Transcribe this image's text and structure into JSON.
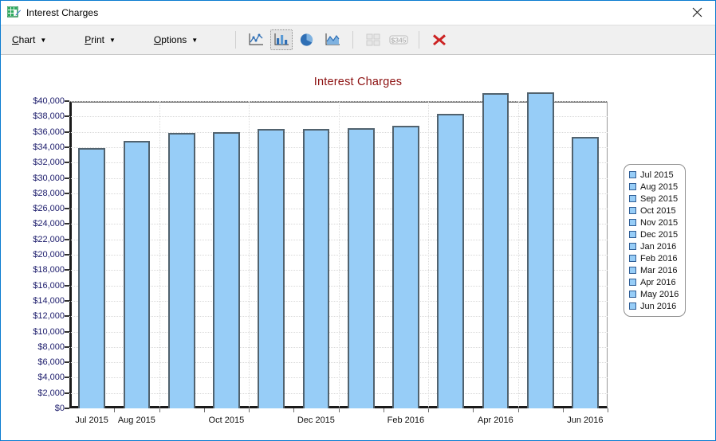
{
  "window": {
    "title": "Interest Charges",
    "icon": "spreadsheet-pen-icon",
    "close_label": "✕"
  },
  "toolbar": {
    "menus": [
      {
        "mnemonic": "C",
        "rest": "hart",
        "caret": "▼",
        "name": "chart"
      },
      {
        "mnemonic": "P",
        "rest": "rint",
        "caret": "▼",
        "name": "print"
      },
      {
        "mnemonic": "O",
        "rest": "ptions",
        "caret": "▼",
        "name": "options"
      }
    ],
    "buttons": [
      {
        "icon": "line-chart-icon",
        "selected": false,
        "disabled": false
      },
      {
        "icon": "bar-chart-icon",
        "selected": true,
        "disabled": false
      },
      {
        "icon": "pie-chart-icon",
        "selected": false,
        "disabled": false
      },
      {
        "icon": "area-chart-icon",
        "selected": false,
        "disabled": false
      },
      {
        "icon": "grid-table-icon",
        "selected": false,
        "disabled": true
      },
      {
        "icon": "numbers-345-icon",
        "selected": false,
        "disabled": true
      },
      {
        "icon": "close-red-x-icon",
        "selected": false,
        "disabled": false
      }
    ],
    "numbers_icon_text": "$345"
  },
  "colors": {
    "bar_fill": "#97cdf7",
    "bar_border": "#51626e",
    "title_text": "#8c1010",
    "axis_label": "#1b1b6b",
    "legend_swatch_border": "#2f5e96",
    "close_x": "#cc2222",
    "window_border": "#0a7bd0"
  },
  "chart_data": {
    "type": "bar",
    "title": "Interest Charges",
    "xlabel": "",
    "ylabel": "",
    "ylim": [
      0,
      40000
    ],
    "ytick_step": 2000,
    "grid": true,
    "legend_position": "right",
    "categories": [
      "Jul 2015",
      "Aug 2015",
      "Sep 2015",
      "Oct 2015",
      "Nov 2015",
      "Dec 2015",
      "Jan 2016",
      "Feb 2016",
      "Mar 2016",
      "Apr 2016",
      "May 2016",
      "Jun 2016"
    ],
    "values": [
      33900,
      34800,
      35900,
      36000,
      36400,
      36400,
      36500,
      36800,
      38300,
      41000,
      41100,
      35300
    ],
    "ytick_labels": [
      "$0",
      "$2,000",
      "$4,000",
      "$6,000",
      "$8,000",
      "$10,000",
      "$12,000",
      "$14,000",
      "$16,000",
      "$18,000",
      "$20,000",
      "$22,000",
      "$24,000",
      "$26,000",
      "$28,000",
      "$30,000",
      "$32,000",
      "$34,000",
      "$36,000",
      "$38,000",
      "$40,000"
    ],
    "xtick_labels_shown": [
      "Jul 2015",
      "Aug 2015",
      "",
      "Oct 2015",
      "",
      "Dec 2015",
      "",
      "Feb 2016",
      "",
      "Apr 2016",
      "",
      "Jun 2016"
    ],
    "legend_entries": [
      "Jul 2015",
      "Aug 2015",
      "Sep 2015",
      "Oct 2015",
      "Nov 2015",
      "Dec 2015",
      "Jan 2016",
      "Feb 2016",
      "Mar 2016",
      "Apr 2016",
      "May 2016",
      "Jun 2016"
    ]
  }
}
